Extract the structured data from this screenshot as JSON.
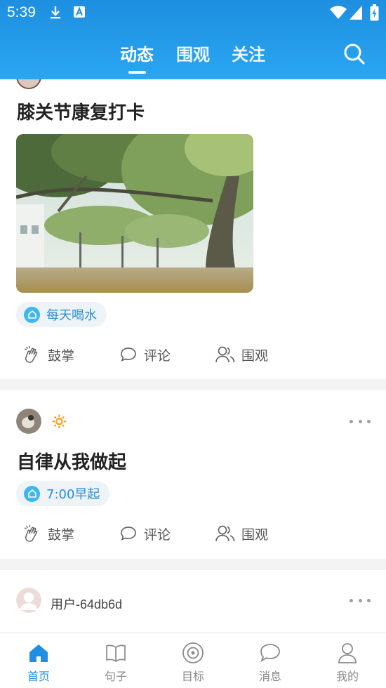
{
  "status": {
    "time": "5:39"
  },
  "header": {
    "tabs": [
      {
        "label": "动态",
        "active": true
      },
      {
        "label": "围观",
        "active": false
      },
      {
        "label": "关注",
        "active": false
      }
    ],
    "accent": "#1e8fe0"
  },
  "posts": [
    {
      "title": "膝关节康复打卡",
      "tag": "每天喝水",
      "actions": {
        "cheer": "鼓掌",
        "comment": "评论",
        "watch": "围观"
      }
    },
    {
      "emoji": "🔅",
      "title": "自律从我做起",
      "tag": "7:00早起",
      "actions": {
        "cheer": "鼓掌",
        "comment": "评论",
        "watch": "围观"
      }
    },
    {
      "username": "用户-64db6d"
    }
  ],
  "bottom_nav": [
    {
      "label": "首页",
      "icon": "home-icon",
      "active": true
    },
    {
      "label": "句子",
      "icon": "book-icon",
      "active": false
    },
    {
      "label": "目标",
      "icon": "target-icon",
      "active": false
    },
    {
      "label": "消息",
      "icon": "chat-icon",
      "active": false
    },
    {
      "label": "我的",
      "icon": "profile-icon",
      "active": false
    }
  ]
}
